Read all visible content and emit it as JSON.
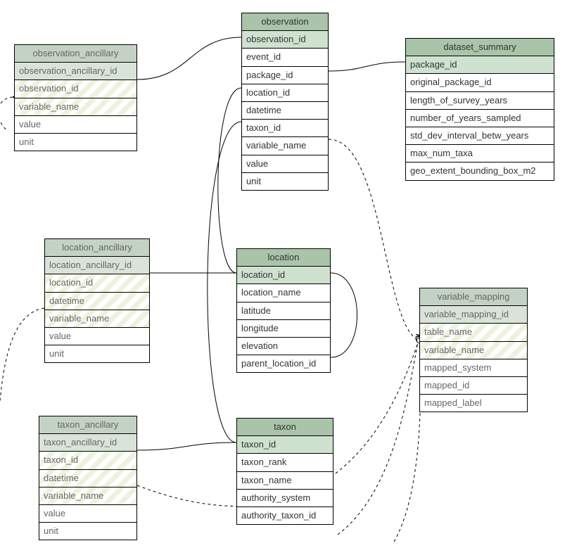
{
  "tables": {
    "observation_ancillary": {
      "title": "observation_ancillary",
      "fields": [
        "observation_ancillary_id",
        "observation_id",
        "variable_name",
        "value",
        "unit"
      ]
    },
    "observation": {
      "title": "observation",
      "fields": [
        "observation_id",
        "event_id",
        "package_id",
        "location_id",
        "datetime",
        "taxon_id",
        "variable_name",
        "value",
        "unit"
      ]
    },
    "dataset_summary": {
      "title": "dataset_summary",
      "fields": [
        "package_id",
        "original_package_id",
        "length_of_survey_years",
        "number_of_years_sampled",
        "std_dev_interval_betw_years",
        "max_num_taxa",
        "geo_extent_bounding_box_m2"
      ]
    },
    "location_ancillary": {
      "title": "location_ancillary",
      "fields": [
        "location_ancillary_id",
        "location_id",
        "datetime",
        "variable_name",
        "value",
        "unit"
      ]
    },
    "location": {
      "title": "location",
      "fields": [
        "location_id",
        "location_name",
        "latitude",
        "longitude",
        "elevation",
        "parent_location_id"
      ]
    },
    "variable_mapping": {
      "title": "variable_mapping",
      "fields": [
        "variable_mapping_id",
        "table_name",
        "variable_name",
        "mapped_system",
        "mapped_id",
        "mapped_label"
      ]
    },
    "taxon_ancillary": {
      "title": "taxon_ancillary",
      "fields": [
        "taxon_ancillary_id",
        "taxon_id",
        "datetime",
        "variable_name",
        "value",
        "unit"
      ]
    },
    "taxon": {
      "title": "taxon",
      "fields": [
        "taxon_id",
        "taxon_rank",
        "taxon_name",
        "authority_system",
        "authority_taxon_id"
      ]
    }
  }
}
